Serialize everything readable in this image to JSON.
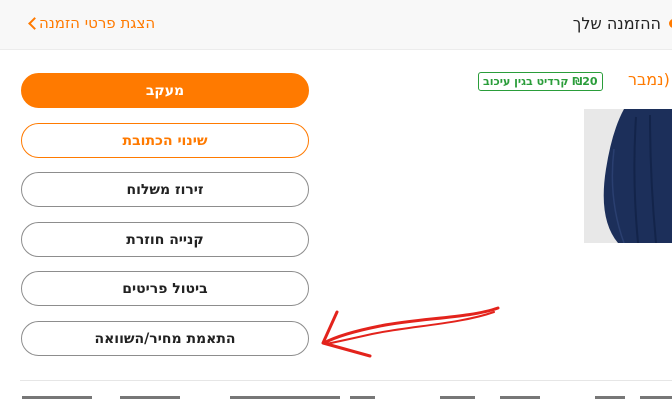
{
  "header": {
    "back_label": "הצגת פרטי הזמנה",
    "order_title": "ההזמנה שלך"
  },
  "product": {
    "name_fragment": "נמבר)",
    "credit_badge": "₪20 קרדיט בגין עיכוב"
  },
  "actions": [
    {
      "label": "מעקב"
    },
    {
      "label": "שינוי הכתובת"
    },
    {
      "label": "זירוז משלוח"
    },
    {
      "label": "קנייה חוזרת"
    },
    {
      "label": "ביטול פריטים"
    },
    {
      "label": "התאמת מחיר/השוואה"
    }
  ],
  "colors": {
    "accent": "#ff7a00",
    "credit_green": "#2a9d3a",
    "annotation_red": "#e3231c",
    "skirt_navy": "#1c2f5a"
  },
  "icons": {
    "back": "chevron-left-icon",
    "status": "orange-dot-icon"
  }
}
